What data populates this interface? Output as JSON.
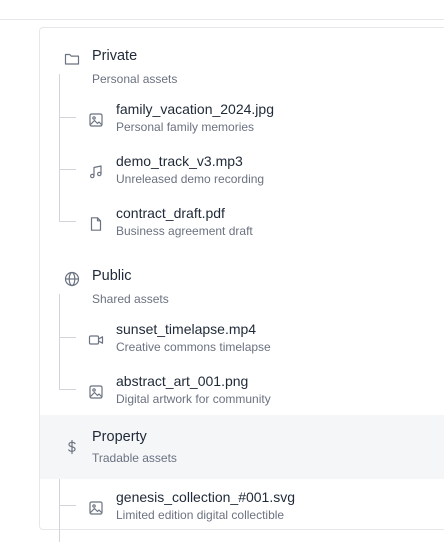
{
  "groups": [
    {
      "title": "Private",
      "subtitle": "Personal assets",
      "icon": "folder-icon",
      "items": [
        {
          "title": "family_vacation_2024.jpg",
          "subtitle": "Personal family memories",
          "icon": "image-icon"
        },
        {
          "title": "demo_track_v3.mp3",
          "subtitle": "Unreleased demo recording",
          "icon": "music-icon"
        },
        {
          "title": "contract_draft.pdf",
          "subtitle": "Business agreement draft",
          "icon": "file-icon"
        }
      ]
    },
    {
      "title": "Public",
      "subtitle": "Shared assets",
      "icon": "globe-icon",
      "items": [
        {
          "title": "sunset_timelapse.mp4",
          "subtitle": "Creative commons timelapse",
          "icon": "video-icon"
        },
        {
          "title": "abstract_art_001.png",
          "subtitle": "Digital artwork for community",
          "icon": "image-icon"
        }
      ]
    },
    {
      "title": "Property",
      "subtitle": "Tradable assets",
      "icon": "dollar-icon",
      "items": [
        {
          "title": "genesis_collection_#001.svg",
          "subtitle": "Limited edition digital collectible",
          "icon": "image-icon"
        }
      ]
    }
  ],
  "colors": {
    "highlight_row": "#f5f6f8",
    "tree_line": "#d1d5db",
    "text_primary": "#1f2937",
    "text_secondary": "#6b7280"
  }
}
